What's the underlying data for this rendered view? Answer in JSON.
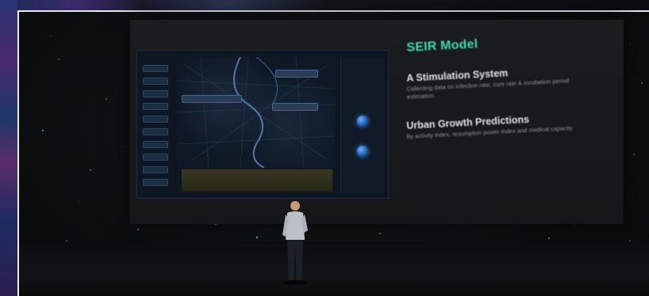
{
  "slide": {
    "title": "SEIR Model",
    "section1_heading": "A Stimulation System",
    "section1_body": "Collecting data on infection rate, cure rate & incubation period estimation",
    "section2_heading": "Urban Growth Predictions",
    "section2_body": "By activity index, resumption power index and medical capacity"
  },
  "colors": {
    "title_accent": "#3fd9b0",
    "heading_text": "#e3e3e3",
    "body_text": "#8f9297",
    "frame_border": "#e9eaec",
    "globe_blue": "#1f5fb8"
  },
  "icons": {
    "globe": "globe-icon"
  }
}
